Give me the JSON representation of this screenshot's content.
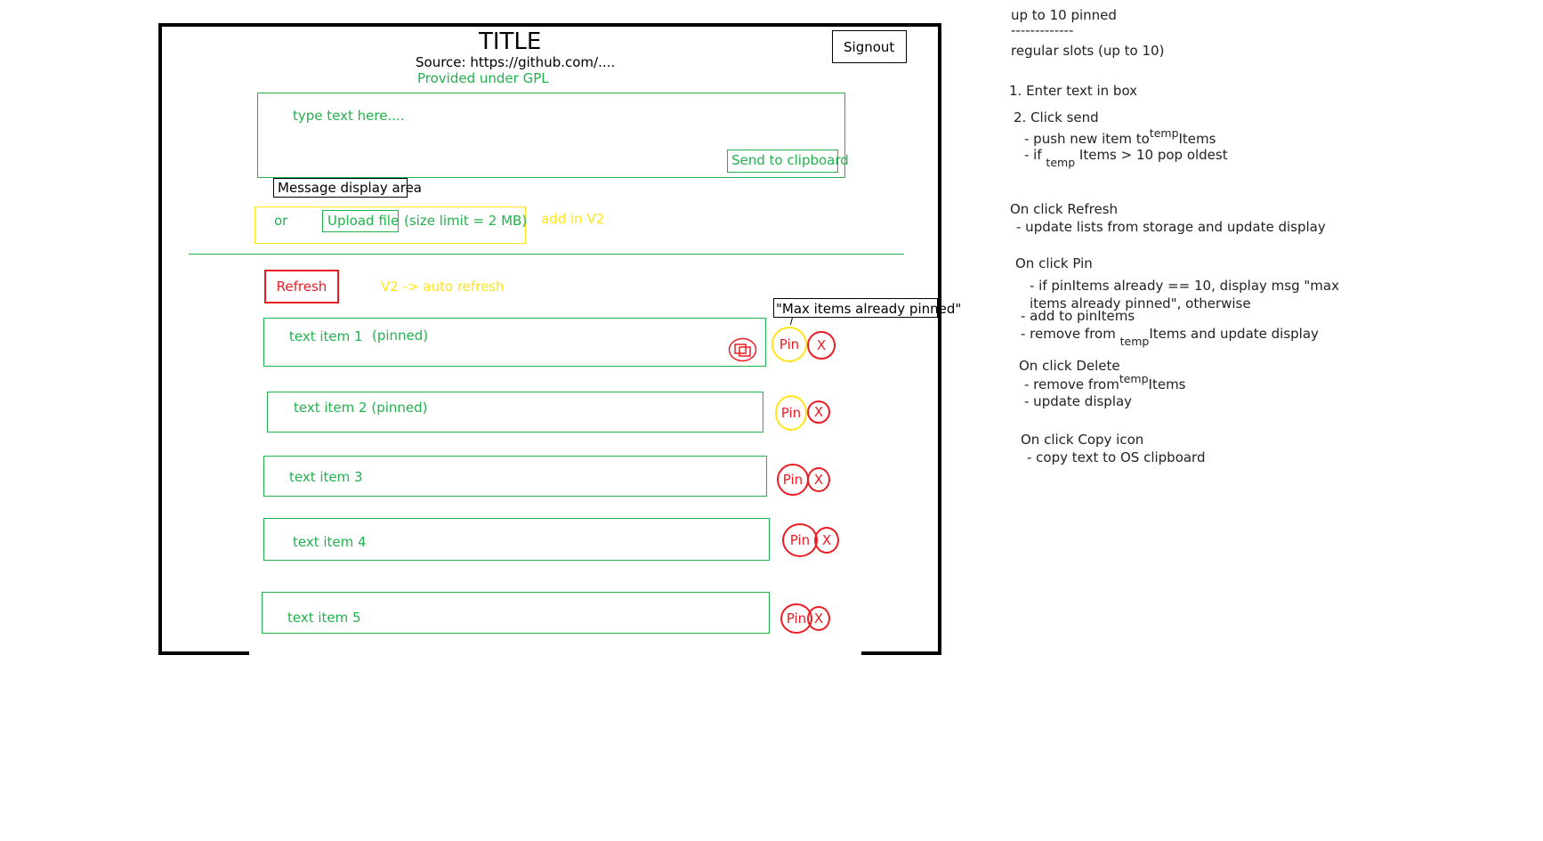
{
  "header": {
    "title": "TITLE",
    "source": "Source: https://github.com/....",
    "license": "Provided under GPL",
    "signout_label": "Signout"
  },
  "input": {
    "placeholder": "type text here....",
    "send_label": "Send to clipboard"
  },
  "message_area_label": "Message display area",
  "upload": {
    "or_label": "or",
    "button_label": "Upload file",
    "size_limit": "(size limit = 2 MB)",
    "v2_note": "add in V2"
  },
  "refresh": {
    "label": "Refresh",
    "v2_note": "V2 -> auto refresh"
  },
  "tooltip": "\"Max items already pinned\"",
  "items": [
    {
      "text": "text item 1",
      "tag": "(pinned)",
      "pin": "Pin",
      "delete": "X"
    },
    {
      "text": "text item 2 (pinned)",
      "pin": "Pin",
      "delete": "X"
    },
    {
      "text": "text item 3",
      "pin": "Pin",
      "delete": "X"
    },
    {
      "text": "text item 4",
      "pin": "Pin",
      "delete": "X"
    },
    {
      "text": "text item 5",
      "pin": "Pin",
      "delete": "X"
    }
  ],
  "icons": {
    "copy": "copy-icon"
  },
  "colors": {
    "green": "#22b14c",
    "red": "#ed1c24",
    "yellow": "#ffe51a"
  },
  "notes": {
    "l1": "up to 10 pinned",
    "l2": "-------------",
    "l3": "regular slots (up to 10)",
    "l4": "1. Enter text in box",
    "l5": "2. Click send",
    "l6a": "- push new item to",
    "l6b": "temp",
    "l6c": "Items",
    "l7a": "- if",
    "l7b": "temp",
    "l7c": "Items > 10 pop oldest",
    "l8": "On click Refresh",
    "l9": "- update lists from storage and update display",
    "l10": "On click Pin",
    "l11": "- if pinItems already == 10, display msg \"max",
    "l12": "items already pinned\", otherwise",
    "l13": "- add to pinItems",
    "l14a": "- remove from",
    "l14b": "temp",
    "l14c": "Items  and update display",
    "l15": "On click Delete",
    "l16a": "- remove from",
    "l16b": "temp",
    "l16c": "Items",
    "l17": "- update display",
    "l18": "On click Copy icon",
    "l19": "- copy text to OS clipboard"
  }
}
